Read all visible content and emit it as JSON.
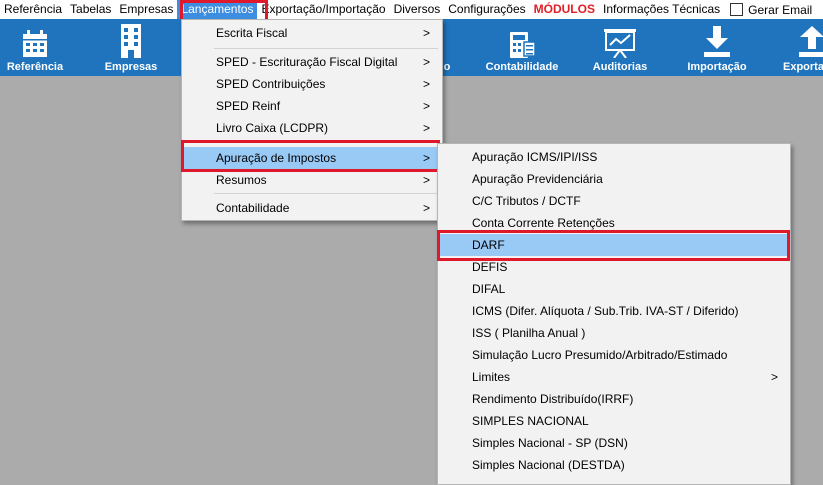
{
  "menubar": {
    "items": [
      "Referência",
      "Tabelas",
      "Empresas",
      "Lançamentos",
      "Exportação/Importação",
      "Diversos",
      "Configurações",
      "MÓDULOS",
      "Informações Técnicas"
    ],
    "checkbox_label": "Gerar Email"
  },
  "toolbar": {
    "buttons": [
      {
        "label": "Referência",
        "icon": "calendar-icon"
      },
      {
        "label": "Empresas",
        "icon": "building-icon"
      },
      {
        "label": "o",
        "icon": "partial-hidden-icon"
      },
      {
        "label": "Contabilidade",
        "icon": "calculator-icon"
      },
      {
        "label": "Auditorias",
        "icon": "presentation-chart-icon"
      },
      {
        "label": "Importação",
        "icon": "download-icon"
      },
      {
        "label": "Exporta",
        "icon": "upload-icon"
      }
    ]
  },
  "lancamentos_menu": {
    "items": [
      {
        "label": "Escrita Fiscal",
        "submenu": true
      },
      {
        "label": "SPED - Escrituração Fiscal Digital",
        "submenu": true
      },
      {
        "label": "SPED Contribuições",
        "submenu": true
      },
      {
        "label": "SPED Reinf",
        "submenu": true
      },
      {
        "label": "Livro Caixa (LCDPR)",
        "submenu": true
      },
      {
        "label": "Apuração de Impostos",
        "submenu": true,
        "highlighted": true
      },
      {
        "label": "Resumos",
        "submenu": true
      },
      {
        "label": "Contabilidade",
        "submenu": true
      }
    ]
  },
  "apuracao_submenu": {
    "items": [
      {
        "label": "Apuração ICMS/IPI/ISS"
      },
      {
        "label": "Apuração Previdenciária"
      },
      {
        "label": "C/C Tributos / DCTF"
      },
      {
        "label": "Conta Corrente Retenções"
      },
      {
        "label": "DARF",
        "highlighted": true
      },
      {
        "label": "DEFIS"
      },
      {
        "label": "DIFAL"
      },
      {
        "label": "ICMS (Difer. Alíquota / Sub.Trib. IVA-ST / Diferido)"
      },
      {
        "label": "ISS ( Planilha Anual )"
      },
      {
        "label": "Simulação Lucro Presumido/Arbitrado/Estimado"
      },
      {
        "label": "Limites",
        "submenu": true
      },
      {
        "label": "Rendimento Distribuído(IRRF)"
      },
      {
        "label": "SIMPLES NACIONAL"
      },
      {
        "label": "Simples Nacional - SP (DSN)"
      },
      {
        "label": "Simples Nacional  (DESTDA)"
      }
    ]
  },
  "arrow_glyph": ">",
  "colors": {
    "toolbar": "#1f74bd",
    "highlight": "#99c9f5",
    "annotation": "#e0182b",
    "modulos": "#e01f26",
    "workspace": "#ababab"
  }
}
